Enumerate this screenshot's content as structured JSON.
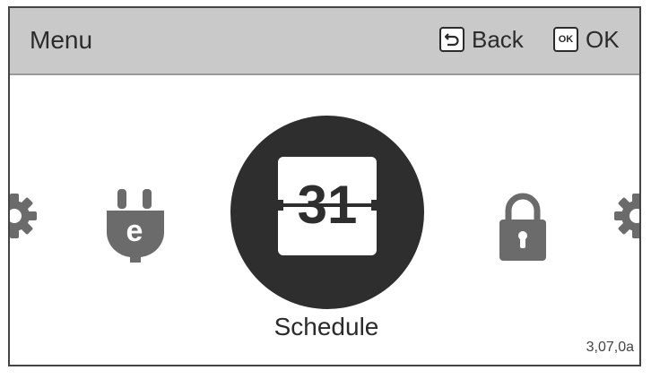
{
  "header": {
    "title": "Menu",
    "back_label": "Back",
    "ok_label": "OK",
    "back_key_icon": "back-arrow-icon",
    "ok_key_icon": "ok-key-icon",
    "ok_key_text": "OK"
  },
  "menu": {
    "items": [
      {
        "icon": "gear-icon"
      },
      {
        "icon": "energy-plug-icon",
        "glyph": "e"
      },
      {
        "icon": "calendar-icon",
        "glyph": "31"
      },
      {
        "icon": "lock-icon"
      },
      {
        "icon": "gear-icon"
      }
    ],
    "selected_label": "Schedule"
  },
  "footer": {
    "version": "3,07,0a"
  },
  "colors": {
    "header_bg": "#c9c9c9",
    "selected_circle": "#2e2e2e",
    "icon_gray": "#6b6b6b",
    "text": "#2b2b2b"
  }
}
